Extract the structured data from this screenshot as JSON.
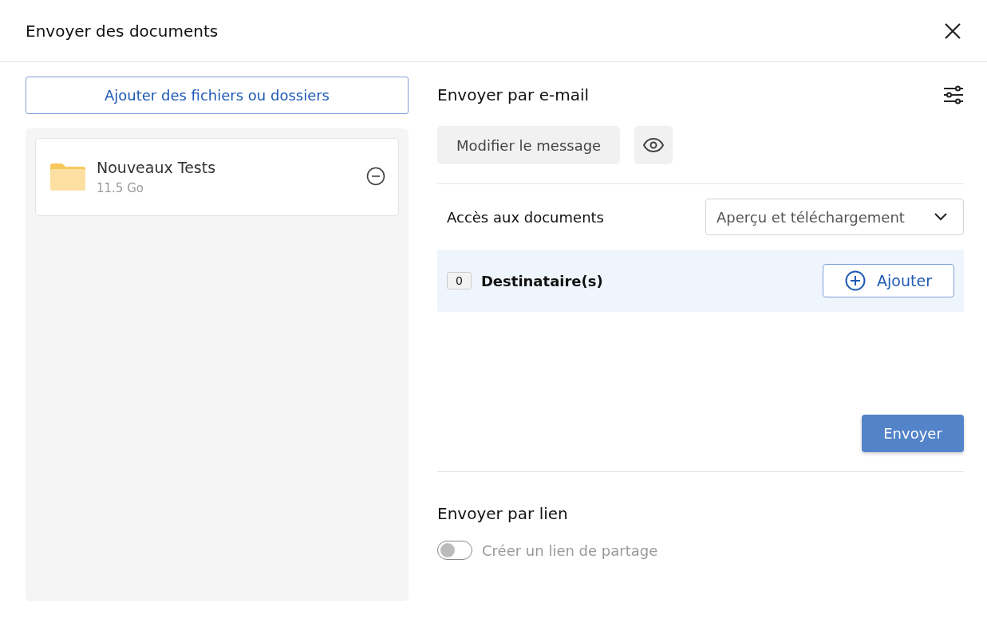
{
  "window": {
    "title": "Envoyer des documents"
  },
  "files": {
    "add_button": "Ajouter des fichiers ou dossiers",
    "items": [
      {
        "name": "Nouveaux Tests",
        "size": "11.5 Go"
      }
    ]
  },
  "email": {
    "title": "Envoyer par e-mail",
    "edit_button": "Modifier le message",
    "access_label": "Accès aux documents",
    "access_value": "Aperçu et téléchargement",
    "recipient_count": "0",
    "recipients_label": "Destinataire(s)",
    "add_recipient": "Ajouter",
    "send_button": {
      "label": "Envoyer",
      "disabled": true
    }
  },
  "link": {
    "title": "Envoyer par lien",
    "toggle": {
      "label": "Créer un lien de partage",
      "on": false,
      "disabled": true
    }
  }
}
